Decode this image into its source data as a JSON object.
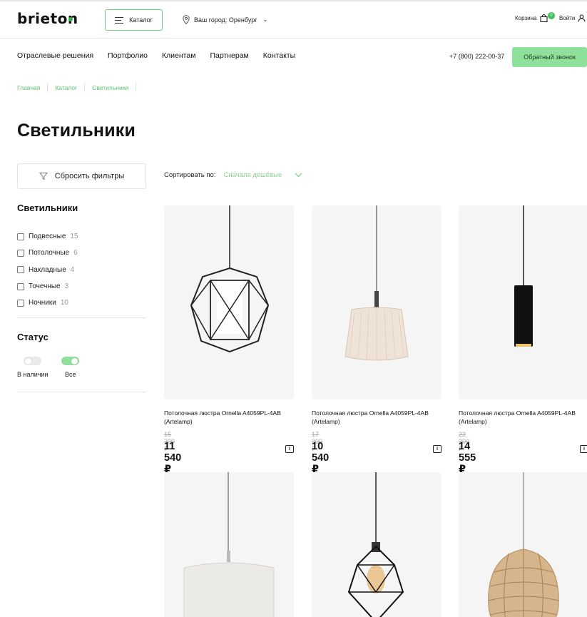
{
  "header": {
    "logo": "brieton",
    "catalog_label": "Каталог",
    "city_label": "Ваш город: Оренбург",
    "cart_label": "Корзина",
    "cart_count": "0",
    "login_label": "Войти"
  },
  "nav": {
    "items": [
      "Отраслевые решения",
      "Портфолио",
      "Клиентам",
      "Партнерам",
      "Контакты"
    ],
    "phone": "+7 (800) 222-00-37",
    "callback_label": "Обратный звонок"
  },
  "breadcrumb": [
    "Главная",
    "Каталог",
    "Светильники"
  ],
  "page_title": "Светильники",
  "filters": {
    "reset_label": "Сбросить фильтры",
    "category_title": "Светильники",
    "categories": [
      {
        "label": "Подвесные",
        "count": "15"
      },
      {
        "label": "Потолочные",
        "count": "6"
      },
      {
        "label": "Накладные",
        "count": "4"
      },
      {
        "label": "Точечные",
        "count": "3"
      },
      {
        "label": "Ночники",
        "count": "10"
      }
    ],
    "status_title": "Статус",
    "status_options": [
      {
        "label": "В наличии",
        "on": false
      },
      {
        "label": "Все",
        "on": true
      }
    ]
  },
  "sort": {
    "label": "Сортировать по:",
    "value": "Сначала дешёвые"
  },
  "products": [
    {
      "name": "Потолочная люстра Ornella A4059PL-4AB (Artelamp)",
      "old_price": "15 300 ₽",
      "price": "11 540 ₽",
      "icon": "wire-cage-lamp"
    },
    {
      "name": "Потолочная люстра Ornella A4059PL-4AB (Artelamp)",
      "old_price": "17 300 ₽",
      "price": "10 540 ₽",
      "icon": "fabric-shade-lamp"
    },
    {
      "name": "Потолочная люстра Ornella A4059PL-4AB (Artelamp)",
      "old_price": "22 300 ₽",
      "price": "14 555 ₽",
      "icon": "cylinder-pendant-lamp"
    },
    {
      "icon": "drum-shade-lamp"
    },
    {
      "icon": "geometric-edison-lamp"
    },
    {
      "icon": "rattan-lamp"
    }
  ],
  "colors": {
    "accent": "#8ee09a",
    "accent_text": "#5cbf6a",
    "card_bg": "#f5f5f5"
  }
}
